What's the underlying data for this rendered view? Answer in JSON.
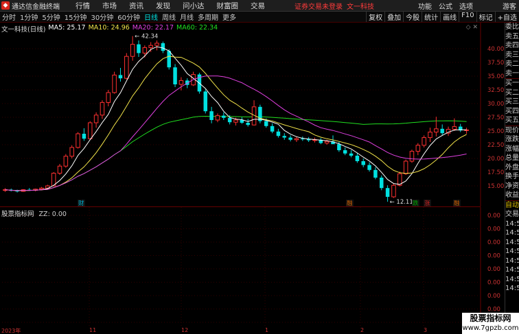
{
  "title_bar": {
    "app_title": "通达信金融终端",
    "menu": [
      "行情",
      "市场",
      "资讯",
      "发现",
      "问小达",
      "财富圈",
      "交易"
    ],
    "notice": "证券交易未登录",
    "stock_name": "文一科技",
    "right_menu": [
      "功能",
      "公式",
      "选项"
    ],
    "user": "游客"
  },
  "toolbar": {
    "periods": [
      "分时",
      "1分钟",
      "5分钟",
      "15分钟",
      "30分钟",
      "60分钟",
      "日线",
      "周线",
      "月线",
      "多周期",
      "更多"
    ],
    "active_period": "日线",
    "tools": [
      "复权",
      "叠加",
      "今股",
      "统计",
      "画线",
      "F10",
      "标记",
      "+自选"
    ]
  },
  "main_chart": {
    "stock_label": "文一科技(日线)",
    "ma5_label": "MA5: 25.17",
    "ma10_label": "MA10: 24.96",
    "ma20_label": "MA20: 22.17",
    "ma60_label": "MA60: 22.34",
    "high_annotation": "42.34",
    "low_annotation": "12.11",
    "event_markers": [
      "财",
      "融",
      "跌",
      "涨",
      "融"
    ],
    "colors": {
      "up": "#ff3030",
      "down": "#00e0e0",
      "ma5": "#ffffff",
      "ma10": "#f2e34a",
      "ma20": "#e040e0",
      "ma60": "#20e020"
    }
  },
  "sub_chart": {
    "indicator_name": "股票指标网",
    "indicator_value": "ZZ: 0.00"
  },
  "x_axis": [
    "2023年",
    "11",
    "12",
    "1",
    "2",
    "3"
  ],
  "chart_data": {
    "type": "candlestick",
    "y_ticks": [
      15.0,
      17.5,
      20.0,
      22.5,
      25.0,
      27.5,
      30.0,
      32.5,
      35.0,
      37.5,
      40.0
    ],
    "ylim": [
      12.0,
      43.0
    ],
    "sub_y_ticks": [
      0.0,
      0.0,
      0.0,
      0.0,
      0.0,
      0.0,
      0.0,
      0.0,
      0.0
    ],
    "candles": [
      [
        14.2,
        14.6,
        13.9,
        14.3
      ],
      [
        14.3,
        14.5,
        14.0,
        14.1
      ],
      [
        14.1,
        14.3,
        13.8,
        14.0
      ],
      [
        14.0,
        14.4,
        13.9,
        14.3
      ],
      [
        14.3,
        14.6,
        14.1,
        14.2
      ],
      [
        14.2,
        14.5,
        14.0,
        14.4
      ],
      [
        14.4,
        14.8,
        14.2,
        14.6
      ],
      [
        14.6,
        15.2,
        14.4,
        15.0
      ],
      [
        15.0,
        17.5,
        14.9,
        17.3
      ],
      [
        17.3,
        19.0,
        17.0,
        18.6
      ],
      [
        18.6,
        20.8,
        18.3,
        20.4
      ],
      [
        20.4,
        22.4,
        20.0,
        22.0
      ],
      [
        22.0,
        24.8,
        21.8,
        24.5
      ],
      [
        24.5,
        25.5,
        23.2,
        23.6
      ],
      [
        23.6,
        26.8,
        23.4,
        26.5
      ],
      [
        26.5,
        28.4,
        25.6,
        27.9
      ],
      [
        27.9,
        30.6,
        27.2,
        30.2
      ],
      [
        30.2,
        32.5,
        29.5,
        32.0
      ],
      [
        32.0,
        35.8,
        31.8,
        35.2
      ],
      [
        35.2,
        36.5,
        34.0,
        34.6
      ],
      [
        34.6,
        39.2,
        34.4,
        38.6
      ],
      [
        38.6,
        42.3,
        37.8,
        40.8
      ],
      [
        40.8,
        41.5,
        38.5,
        39.2
      ],
      [
        39.2,
        40.6,
        38.4,
        40.2
      ],
      [
        40.2,
        41.2,
        39.4,
        40.6
      ],
      [
        40.6,
        41.5,
        39.7,
        41.0
      ],
      [
        41.0,
        41.3,
        39.2,
        39.6
      ],
      [
        39.6,
        39.9,
        36.2,
        36.6
      ],
      [
        36.6,
        37.2,
        33.0,
        33.5
      ],
      [
        33.5,
        34.8,
        32.4,
        34.2
      ],
      [
        34.2,
        34.6,
        32.8,
        33.4
      ],
      [
        33.4,
        35.8,
        33.2,
        35.3
      ],
      [
        35.3,
        35.6,
        31.8,
        32.2
      ],
      [
        32.2,
        32.6,
        28.2,
        28.6
      ],
      [
        28.6,
        29.4,
        26.4,
        27.0
      ],
      [
        27.0,
        28.2,
        26.6,
        27.8
      ],
      [
        27.8,
        28.4,
        27.0,
        27.4
      ],
      [
        27.4,
        27.9,
        26.2,
        26.6
      ],
      [
        26.6,
        27.4,
        26.0,
        27.0
      ],
      [
        27.0,
        27.5,
        26.3,
        26.5
      ],
      [
        26.5,
        27.2,
        25.8,
        26.1
      ],
      [
        26.1,
        30.6,
        26.0,
        29.4
      ],
      [
        29.4,
        29.8,
        26.4,
        26.8
      ],
      [
        26.8,
        27.3,
        25.6,
        25.9
      ],
      [
        25.9,
        26.4,
        24.6,
        24.9
      ],
      [
        24.9,
        25.4,
        23.8,
        24.1
      ],
      [
        24.1,
        24.6,
        23.4,
        23.8
      ],
      [
        23.8,
        24.2,
        23.1,
        23.4
      ],
      [
        23.4,
        24.0,
        23.0,
        23.6
      ],
      [
        23.6,
        24.0,
        23.2,
        23.5
      ],
      [
        23.5,
        23.9,
        23.0,
        23.3
      ],
      [
        23.3,
        23.8,
        22.9,
        23.4
      ],
      [
        23.4,
        23.7,
        22.6,
        22.8
      ],
      [
        22.8,
        23.4,
        22.5,
        23.1
      ],
      [
        23.1,
        24.2,
        22.9,
        22.6
      ],
      [
        22.6,
        23.0,
        21.2,
        21.5
      ],
      [
        21.5,
        22.0,
        20.6,
        20.9
      ],
      [
        20.9,
        21.5,
        20.2,
        20.5
      ],
      [
        20.5,
        21.0,
        19.2,
        19.5
      ],
      [
        19.5,
        20.0,
        18.4,
        18.8
      ],
      [
        18.8,
        19.3,
        17.6,
        17.9
      ],
      [
        17.9,
        18.4,
        16.2,
        16.5
      ],
      [
        16.5,
        16.9,
        14.2,
        14.6
      ],
      [
        14.6,
        15.1,
        12.1,
        13.0
      ],
      [
        13.0,
        15.4,
        12.8,
        15.1
      ],
      [
        15.1,
        17.6,
        14.9,
        17.2
      ],
      [
        17.2,
        19.8,
        17.0,
        19.5
      ],
      [
        19.5,
        21.6,
        19.2,
        21.3
      ],
      [
        21.3,
        22.8,
        20.6,
        22.4
      ],
      [
        22.4,
        24.2,
        22.0,
        23.8
      ],
      [
        23.8,
        25.6,
        23.0,
        24.8
      ],
      [
        24.8,
        27.6,
        24.0,
        25.4
      ],
      [
        25.4,
        26.2,
        24.2,
        24.6
      ],
      [
        24.6,
        25.8,
        24.1,
        25.3
      ],
      [
        25.3,
        27.3,
        25.0,
        25.8
      ],
      [
        25.8,
        26.3,
        24.8,
        25.1
      ],
      [
        25.1,
        25.6,
        24.5,
        25.2
      ]
    ]
  }
}
